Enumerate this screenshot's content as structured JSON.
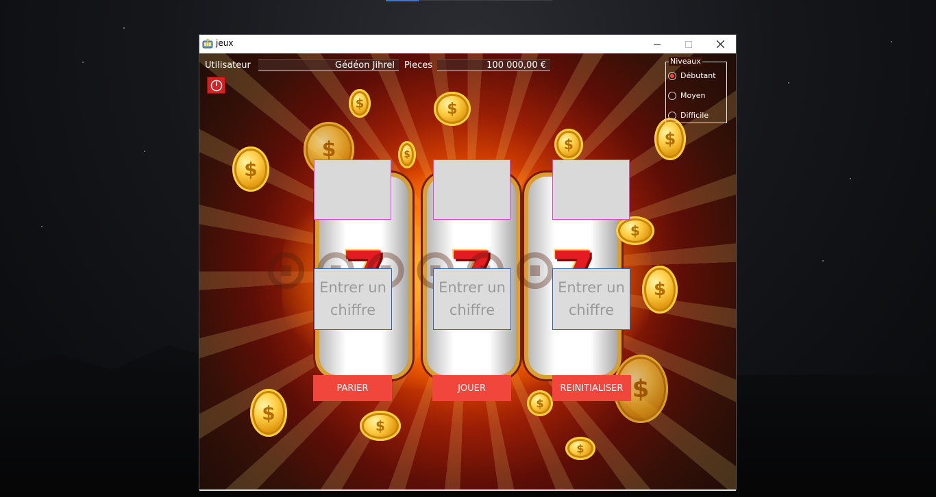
{
  "window": {
    "title": "jeux"
  },
  "header": {
    "user_label": "Utilisateur",
    "user_value": "Gédéon Jihrel",
    "coins_label": "Pieces",
    "coins_value": "100 000,00 €"
  },
  "levels": {
    "legend": "Niveaux",
    "options": [
      {
        "label": "Débutant",
        "checked": true
      },
      {
        "label": "Moyen",
        "checked": false
      },
      {
        "label": "Difficile",
        "checked": false
      }
    ]
  },
  "inputs": {
    "placeholder": "Entrer un chiffre"
  },
  "buttons": {
    "bet": "PARIER",
    "play": "JOUER",
    "reset": "REINITIALISER"
  },
  "icons": {
    "app": "slot-machine-icon",
    "power": "power-icon"
  },
  "colors": {
    "button_red": "#f0463b",
    "slot_border": "#e040e0",
    "input_border": "#2f63b8",
    "radio_checked": "#ff4040"
  }
}
